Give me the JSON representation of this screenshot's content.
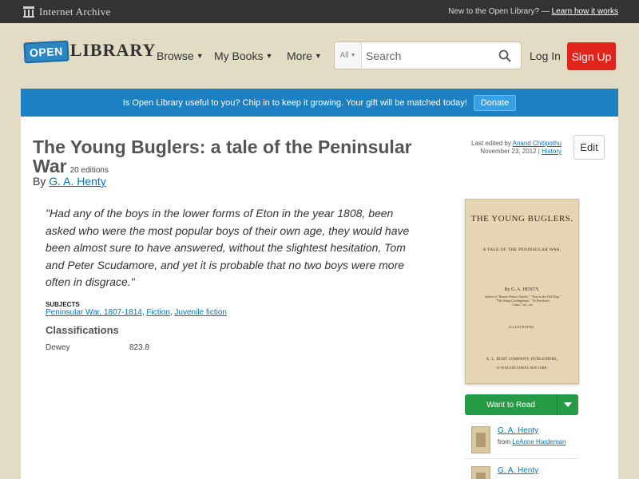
{
  "ia_bar": {
    "title": "Internet Archive",
    "prompt": "New to the Open Library? —",
    "link": "Learn how it works"
  },
  "header": {
    "logo_open": "OPEN",
    "logo_library": "LIBRARY",
    "nav": [
      {
        "label": "Browse"
      },
      {
        "label": "My Books"
      },
      {
        "label": "More"
      }
    ],
    "search_scope": "All",
    "search_placeholder": "Search",
    "login": "Log In",
    "signup": "Sign Up"
  },
  "donate": {
    "message": "Is Open Library useful to you? Chip in to keep it growing. Your gift will be matched today!",
    "button": "Donate"
  },
  "book": {
    "title": "The Young Buglers: a tale of the Peninsular War",
    "editions": "20 editions",
    "by": "By",
    "author": "G. A. Henty",
    "excerpt": "\"Had any of the boys in the lower forms of Eton in the year 1808, been asked who were the most popular boys of their own age, they would have been almost sure to have answered, without the slightest hesitation, Tom and Peter Scudamore, and yet it is probable that no two boys were more often in disgrace.\"",
    "subjects_label": "SUBJECTS",
    "subjects": [
      "Peninsular War, 1807-1814",
      "Fiction",
      "Juvenile fiction"
    ],
    "classifications_heading": "Classifications",
    "class_label": "Dewey",
    "class_value": "823.8"
  },
  "edit_info": {
    "prefix": "Last edited by",
    "editor": "Anand Chitipothu",
    "date": "November 23, 2012",
    "separator": "|",
    "history": "History",
    "edit_button": "Edit"
  },
  "cover": {
    "title": "THE YOUNG BUGLERS.",
    "subtitle": "A TALE OF THE PENINSULAR WAR.",
    "author": "By G. A. HENTY,",
    "small_line1": "Author of \"Bonnie Prince Charlie,\" \"True to the Old Flag,\"",
    "small_line2": "\"The Young Carthaginian,\" \"In Freedom's",
    "small_line3": "Cause,\" etc., etc.",
    "illustrated": "ILLUSTRATED.",
    "publisher": "A. L. BURT COMPANY, PUBLISHERS,",
    "address": "52-58 DUANE STREET, NEW YORK."
  },
  "want_to_read": "Want to Read",
  "edition_list": [
    {
      "author": "G. A. Henty",
      "from": "from",
      "source": "LeAnne Hardeman"
    },
    {
      "author": "G. A. Henty"
    }
  ],
  "colors": {
    "ia_bar": "#333333",
    "page_bg": "#e2dcc5",
    "donate_bg": "#1d80c3",
    "signup": "#e1251b",
    "want_to_read": "#259b46",
    "link": "#0376b8"
  }
}
